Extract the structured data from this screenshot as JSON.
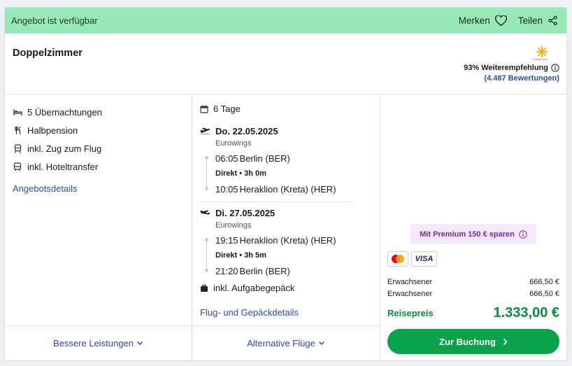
{
  "banner": {
    "status": "Angebot ist verfügbar",
    "save_label": "Merken",
    "share_label": "Teilen",
    "color": "#97eab5"
  },
  "room": {
    "title": "Doppelzimmer",
    "recommendation": "93% Weiterempfehlung",
    "reviews": "(4.487 Bewertungen)",
    "logo_text": "HolidayCheck"
  },
  "features": [
    {
      "icon": "bed-icon",
      "label": "5 Übernachtungen"
    },
    {
      "icon": "cutlery-icon",
      "label": "Halbpension"
    },
    {
      "icon": "train-icon",
      "label": "inkl. Zug zum Flug"
    },
    {
      "icon": "bus-icon",
      "label": "inkl. Hoteltransfer"
    }
  ],
  "offer_details_link": "Angebotsdetails",
  "better_services_tab": "Bessere Leistungen",
  "travel": {
    "duration": "6 Tage",
    "outbound": {
      "date": "Do. 22.05.2025",
      "airline": "Eurowings",
      "dep_time": "06:05",
      "dep_place": "Berlin (BER)",
      "info": "Direkt • 3h 0m",
      "arr_time": "10:05",
      "arr_place": "Heraklion (Kreta) (HER)"
    },
    "return": {
      "date": "Di. 27.05.2025",
      "airline": "Eurowings",
      "dep_time": "19:15",
      "dep_place": "Heraklion (Kreta) (HER)",
      "info": "Direkt • 3h 5m",
      "arr_time": "21:20",
      "arr_place": "Berlin (BER)"
    },
    "baggage": "inkl. Aufgabegepäck",
    "details_link": "Flug- und Gepäckdetails",
    "alt_flights_tab": "Alternative Flüge"
  },
  "pricing": {
    "premium": "Mit Premium 150 € sparen",
    "payment_methods": [
      "mastercard-icon",
      "visa-icon"
    ],
    "visa_text": "VISA",
    "travellers": [
      {
        "label": "Erwachsener",
        "price": "666,50 €"
      },
      {
        "label": "Erwachsener",
        "price": "666,50 €"
      }
    ],
    "total_label": "Reisepreis",
    "total_price": "1.333,00 €",
    "book_label": "Zur Buchung",
    "accent": "#0aa24a"
  }
}
